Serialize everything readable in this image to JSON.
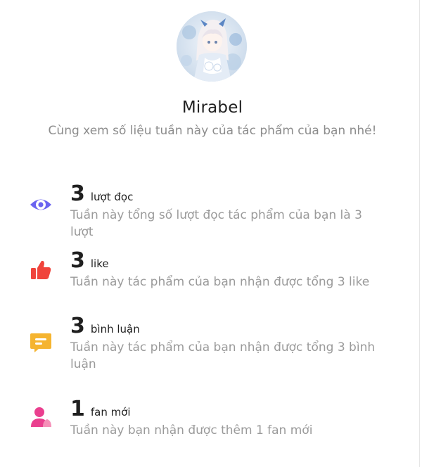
{
  "profile": {
    "name": "Mirabel",
    "subtitle": "Cùng xem số liệu tuần này của tác phẩm của bạn nhé!",
    "avatar_icon": "anime-avatar-icon"
  },
  "stats": [
    {
      "value": "3",
      "unit": "lượt đọc",
      "description": "Tuần này tổng số lượt đọc tác phẩm của bạn là 3 lượt",
      "icon": "eye-icon",
      "color": "#6a63f0"
    },
    {
      "value": "3",
      "unit": "like",
      "description": "Tuần này tác phẩm của bạn nhận được tổng 3 like",
      "icon": "thumbs-up-icon",
      "color": "#f0443c"
    },
    {
      "value": "3",
      "unit": "bình luận",
      "description": "Tuần này tác phẩm của bạn nhận được tổng 3 bình luận",
      "icon": "comment-icon",
      "color": "#f5b430"
    },
    {
      "value": "1",
      "unit": "fan mới",
      "description": "Tuần này bạn nhận được thêm 1 fan mới",
      "icon": "user-icon",
      "color": "#ea3f8f"
    }
  ]
}
